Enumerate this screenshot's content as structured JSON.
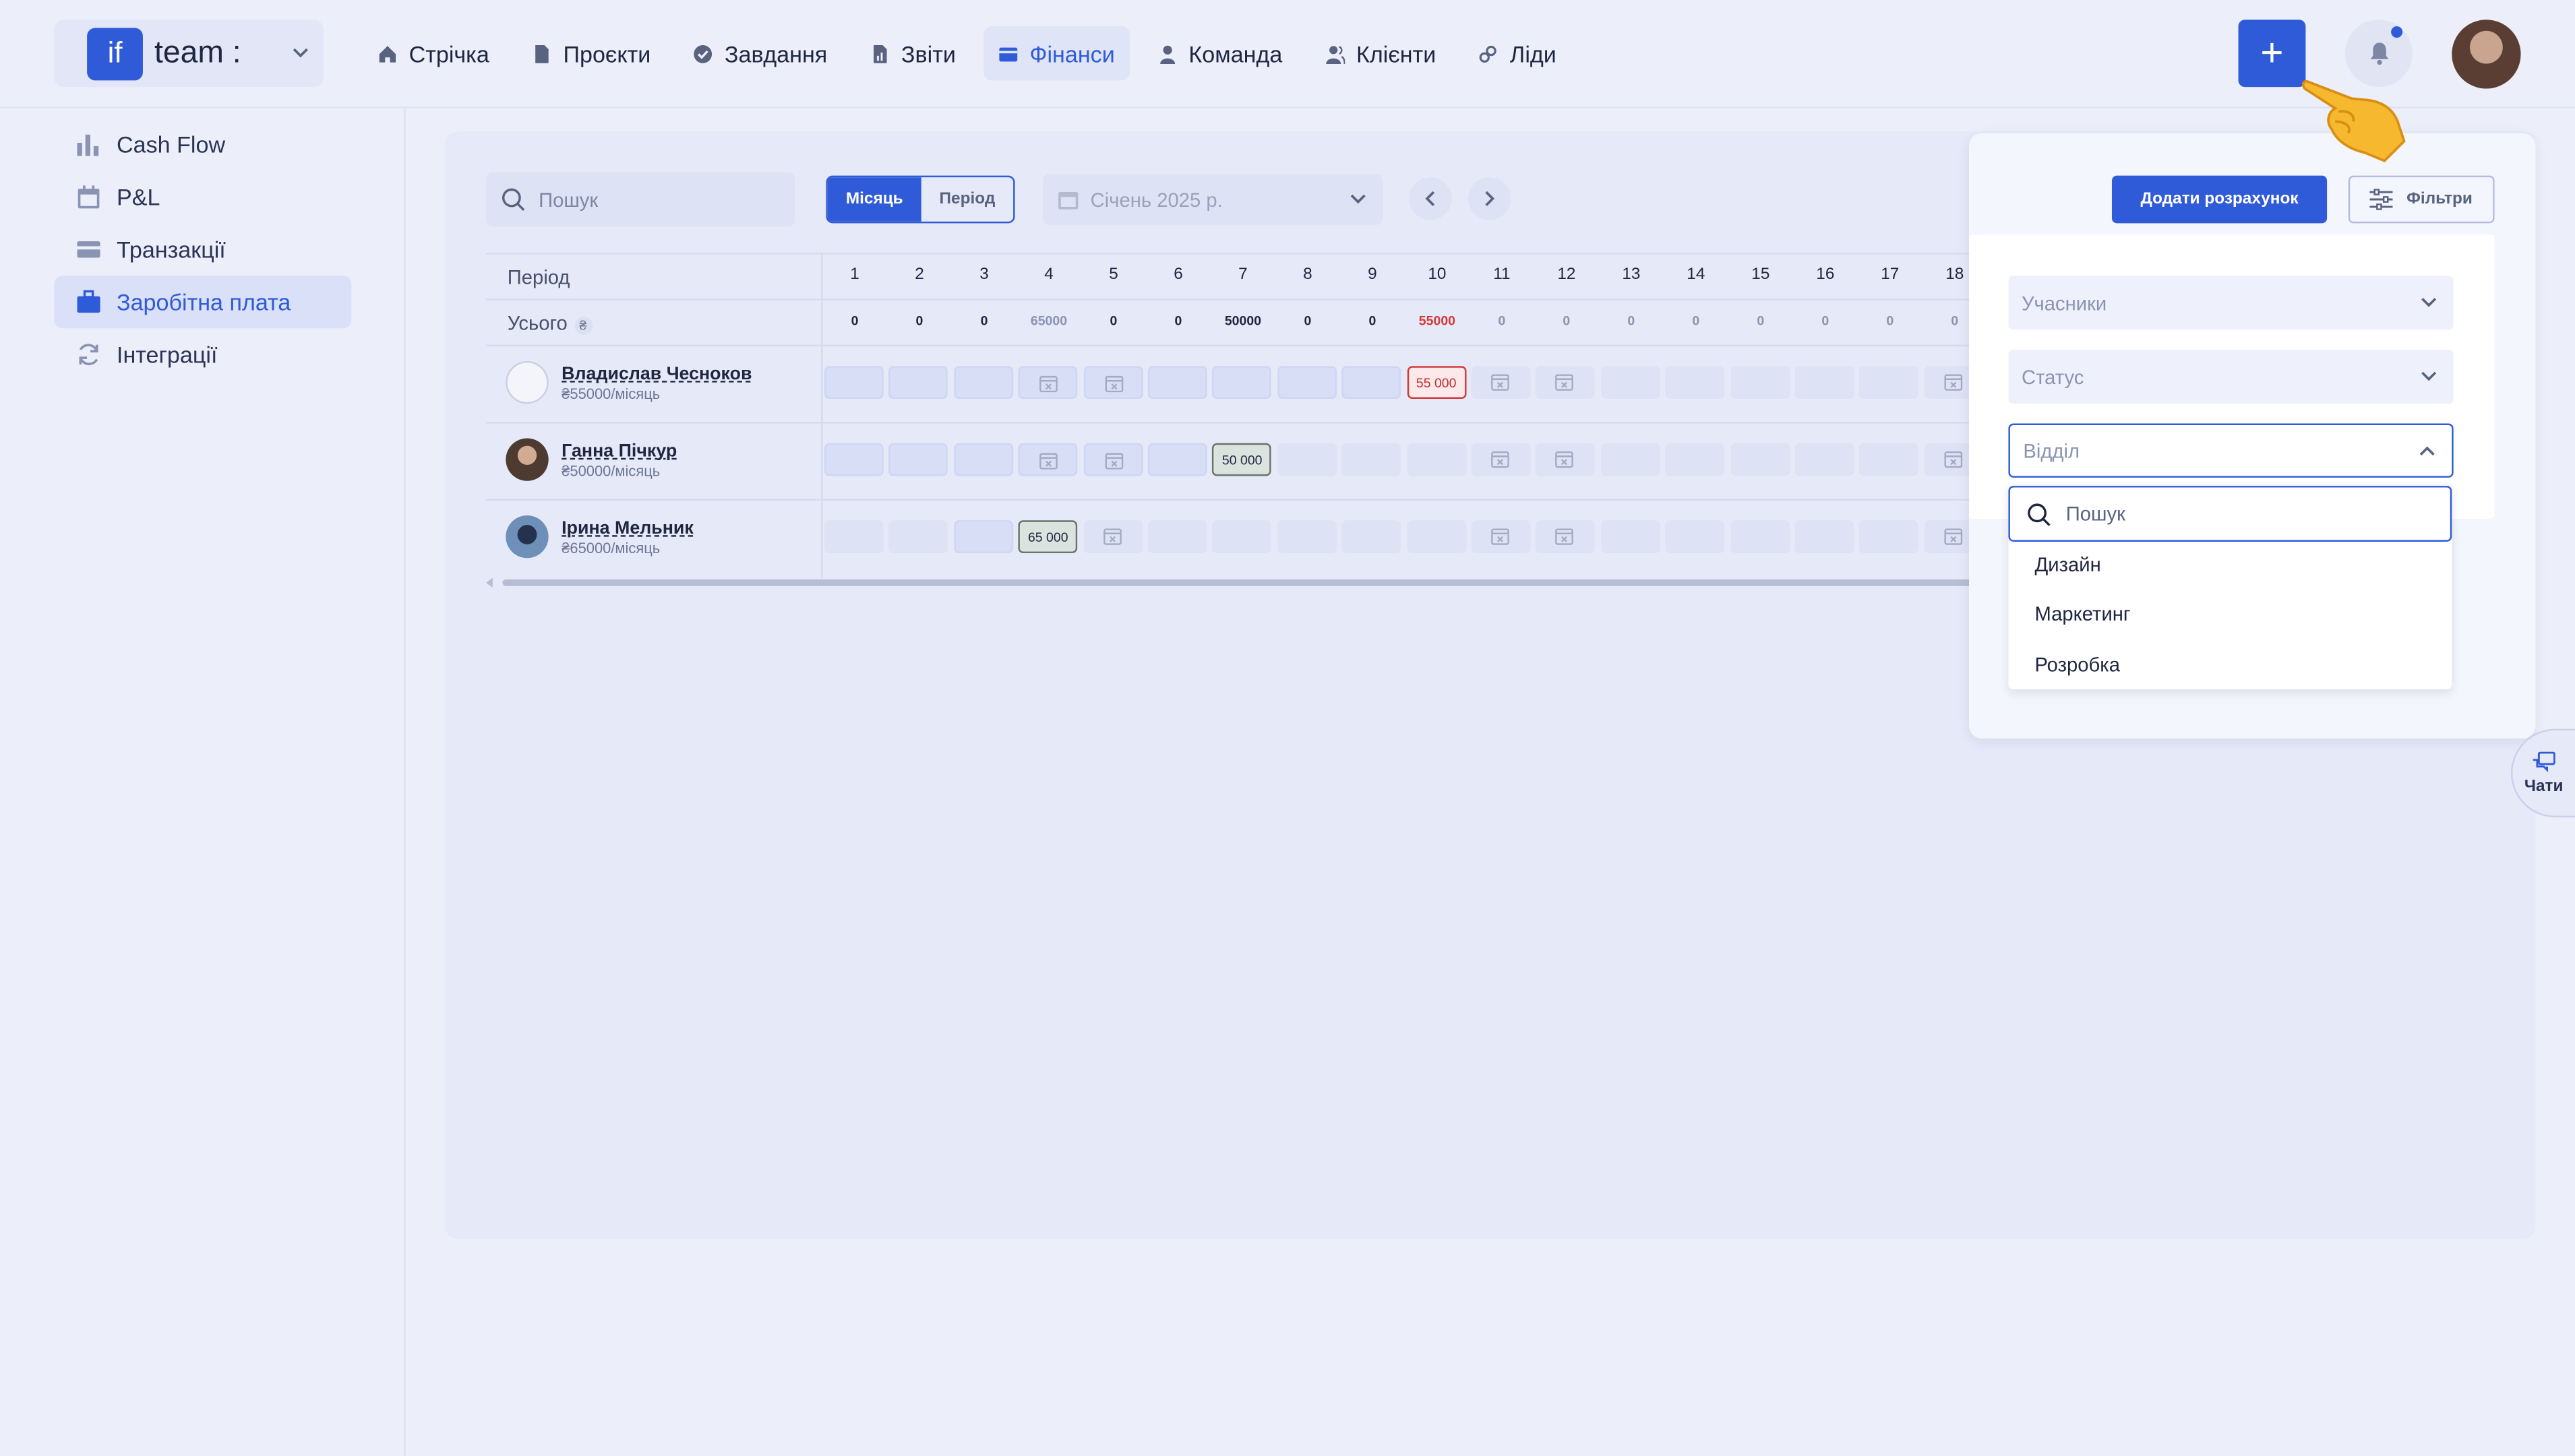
{
  "brand": {
    "logo": "if",
    "name": "team :"
  },
  "nav": [
    {
      "label": "Стрічка",
      "icon": "home-icon"
    },
    {
      "label": "Проєкти",
      "icon": "file-icon"
    },
    {
      "label": "Завдання",
      "icon": "check-circle-icon"
    },
    {
      "label": "Звіти",
      "icon": "report-icon"
    },
    {
      "label": "Фінанси",
      "icon": "wallet-icon",
      "active": true
    },
    {
      "label": "Команда",
      "icon": "user-icon"
    },
    {
      "label": "Клієнти",
      "icon": "users-icon"
    },
    {
      "label": "Ліди",
      "icon": "link-icon"
    }
  ],
  "header": {
    "plus": "+"
  },
  "sidebar": {
    "items": [
      {
        "label": "Cash Flow",
        "icon": "chart-icon"
      },
      {
        "label": "P&L",
        "icon": "calendar-icon"
      },
      {
        "label": "Транзакції",
        "icon": "card-icon"
      },
      {
        "label": "Заробітна плата",
        "icon": "briefcase-icon",
        "active": true
      },
      {
        "label": "Інтеграції",
        "icon": "sync-icon"
      }
    ]
  },
  "toolbar": {
    "search_placeholder": "Пошук",
    "mode_month": "Місяць",
    "mode_period": "Період",
    "date": "Січень 2025 р."
  },
  "table": {
    "period_label": "Період",
    "total_label": "Усього",
    "currency": "₴",
    "days": [
      "1",
      "2",
      "3",
      "4",
      "5",
      "6",
      "7",
      "8",
      "9",
      "10",
      "11",
      "12",
      "13",
      "14",
      "15",
      "16",
      "17",
      "18"
    ],
    "totals": [
      "0",
      "0",
      "0",
      "65000",
      "0",
      "0",
      "50000",
      "0",
      "0",
      "55000",
      "0",
      "0",
      "0",
      "0",
      "0",
      "0",
      "0",
      "0"
    ],
    "people": [
      {
        "name": "Владислав Чесноков",
        "rate": "₴55000/місяць",
        "amount_day": 10,
        "amount": "55 000"
      },
      {
        "name": "Ганна Пічкур",
        "rate": "₴50000/місяць",
        "amount_day": 7,
        "amount": "50 000"
      },
      {
        "name": "Ірина Мельник",
        "rate": "₴65000/місяць",
        "amount_day": 4,
        "amount": "65 000"
      }
    ]
  },
  "filters": {
    "add_button": "Додати розрахунок",
    "filter_button": "Фільтри",
    "participants": "Учасники",
    "status": "Статус",
    "department": "Відділ",
    "dropdown_search": "Пошук",
    "options": [
      "Дизайн",
      "Маркетинг",
      "Розробка"
    ]
  },
  "chat": {
    "label": "Чати"
  },
  "colors": {
    "accent": "#2f5bd8",
    "danger": "#d33a3a",
    "background": "#eceffa"
  }
}
